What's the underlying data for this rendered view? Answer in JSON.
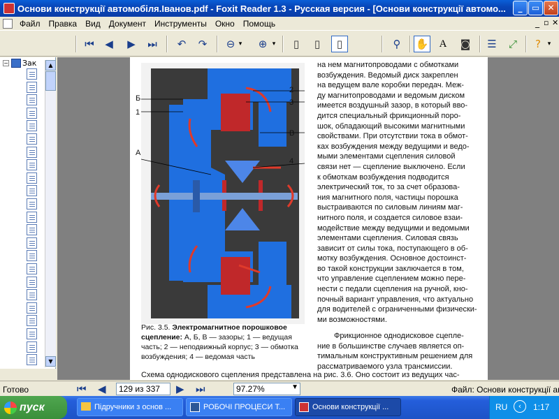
{
  "window": {
    "title": "Основи конструкції автомобіля.Іванов.pdf - Foxit Reader 1.3 - Русская версия  - [Основи конструкції автомо..."
  },
  "menu": [
    "Файл",
    "Правка",
    "Вид",
    "Документ",
    "Инструменты",
    "Окно",
    "Помощь"
  ],
  "toolbar": {
    "buttons": [
      "first-page",
      "prev-page",
      "next-page",
      "last-page",
      "rotate-left",
      "rotate-right",
      "zoom-out",
      "zoom-in",
      "single-page",
      "continuous",
      "facing",
      "find",
      "hand",
      "select-text",
      "snapshot",
      "bookmarks",
      "fullscreen",
      "help"
    ]
  },
  "leftpanel": {
    "root_label": "Зак"
  },
  "document": {
    "figure_labels": {
      "b": "Б",
      "one": "1",
      "a": "А",
      "two": "2",
      "three": "3",
      "v": "В",
      "four": "4"
    },
    "caption_prefix": "Рис. 3.5.",
    "caption_bold": "Электромагнитное порошковое сцепление:",
    "caption_rest": "А, Б, В — зазоры; 1 — ведущая часть; 2 — неподвижный корпус; 3 — обмотка возбуждения; 4 — ведомая часть",
    "column_right": [
      "на нем магнитопроводами с обмотками",
      "возбуждения. Ведомый диск закреплен",
      "на ведущем вале коробки передач. Меж-",
      "ду магнитопроводами и ведомым диском",
      "имеется воздушный зазор, в который вво-",
      "дится специальный фрикционный поро-",
      "шок, обладающий высокими магнитными",
      "свойствами. При отсутствии тока в обмот-",
      "ках возбуждения между ведущими и ведо-",
      "мыми элементами сцепления силовой",
      "связи нет — сцепление выключено. Если",
      "к обмоткам возбуждения подводится",
      "электрический ток, то за счет образова-",
      "ния магнитного поля, частицы порошка",
      "выстраиваются по силовым линиям маг-",
      "нитного поля, и создается силовое взаи-",
      "модействие между ведущими и ведомыми",
      "элементами сцепления. Силовая связь",
      "зависит от силы тока, поступающего в об-",
      "мотку возбуждения. Основное достоинст-",
      "во такой конструкции заключается в том,",
      "что управление сцеплением можно пере-",
      "нести с педали сцепления на ручной, кно-",
      "почный вариант управления, что актуально",
      "для водителей с ограниченными физически-",
      "ми возможностями."
    ],
    "column_right_p2": [
      "Фрикционное однодисковое сцепле-",
      "ние в большинстве случаев является оп-",
      "тимальным конструктивным решением для",
      "рассматриваемого узла трансмиссии."
    ],
    "bottom_line": "Схема однодискового сцепления представлена на рис. 3.6. Оно состоит из ведущих час-"
  },
  "status": {
    "ready": "Готово",
    "page_value": "129 из 337",
    "zoom_value": "97.27%",
    "file": "Файл: Основи конструкції автом"
  },
  "taskbar": {
    "start": "пуск",
    "tasks": [
      "Підручники з основ ...",
      "РОБОЧІ ПРОЦЕСИ Т...",
      "Основи конструкції ..."
    ],
    "lang": "RU",
    "clock": "1:17"
  },
  "colors": {
    "figure_blue": "#1f6fe0",
    "coil_red": "#c0282a",
    "arrow_red": "#e03a2a"
  }
}
